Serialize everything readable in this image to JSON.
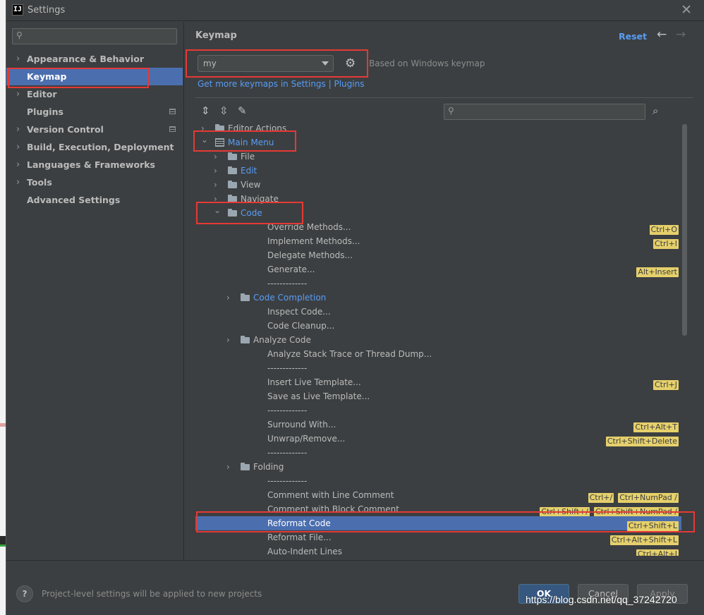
{
  "window": {
    "title": "Settings",
    "app_icon_text": "IJ"
  },
  "sidebar": {
    "search_placeholder": "",
    "items": [
      {
        "label": "Appearance & Behavior",
        "expandable": true
      },
      {
        "label": "Keymap",
        "expandable": false,
        "selected": true
      },
      {
        "label": "Editor",
        "expandable": true
      },
      {
        "label": "Plugins",
        "expandable": false,
        "side_icon": true
      },
      {
        "label": "Version Control",
        "expandable": true,
        "side_icon": true
      },
      {
        "label": "Build, Execution, Deployment",
        "expandable": true
      },
      {
        "label": "Languages & Frameworks",
        "expandable": true
      },
      {
        "label": "Tools",
        "expandable": true
      },
      {
        "label": "Advanced Settings",
        "expandable": false
      }
    ]
  },
  "header": {
    "title": "Keymap",
    "reset_label": "Reset"
  },
  "keymap": {
    "selected": "my",
    "based_on": "Based on Windows keymap",
    "link_settings": "Get more keymaps in Settings",
    "link_separator": " | ",
    "link_plugins": "Plugins"
  },
  "tree_search": {
    "placeholder": ""
  },
  "tree": [
    {
      "label": "Editor Actions",
      "indent": 0,
      "chevron": "right",
      "icon": "folder"
    },
    {
      "label": "Main Menu",
      "indent": 0,
      "chevron": "down",
      "icon": "menu",
      "blue": true
    },
    {
      "label": "File",
      "indent": 1,
      "chevron": "right",
      "icon": "folder"
    },
    {
      "label": "Edit",
      "indent": 1,
      "chevron": "right",
      "icon": "folder",
      "blue": true
    },
    {
      "label": "View",
      "indent": 1,
      "chevron": "right",
      "icon": "folder"
    },
    {
      "label": "Navigate",
      "indent": 1,
      "chevron": "right",
      "icon": "folder"
    },
    {
      "label": "Code",
      "indent": 1,
      "chevron": "down",
      "icon": "folder",
      "blue": true
    },
    {
      "label": "Override Methods...",
      "indent": 2,
      "shortcuts": [
        "Ctrl+O"
      ]
    },
    {
      "label": "Implement Methods...",
      "indent": 2,
      "shortcuts": [
        "Ctrl+I"
      ]
    },
    {
      "label": "Delegate Methods...",
      "indent": 2
    },
    {
      "label": "Generate...",
      "indent": 2,
      "shortcuts": [
        "Alt+Insert"
      ]
    },
    {
      "label": "-------------",
      "indent": 2
    },
    {
      "label": "Code Completion",
      "indent": 2,
      "chevron": "right",
      "icon": "folder",
      "blue": true
    },
    {
      "label": "Inspect Code...",
      "indent": 2
    },
    {
      "label": "Code Cleanup...",
      "indent": 2
    },
    {
      "label": "Analyze Code",
      "indent": 2,
      "chevron": "right",
      "icon": "folder"
    },
    {
      "label": "Analyze Stack Trace or Thread Dump...",
      "indent": 2
    },
    {
      "label": "-------------",
      "indent": 2
    },
    {
      "label": "Insert Live Template...",
      "indent": 2,
      "shortcuts": [
        "Ctrl+J"
      ]
    },
    {
      "label": "Save as Live Template...",
      "indent": 2
    },
    {
      "label": "-------------",
      "indent": 2
    },
    {
      "label": "Surround With...",
      "indent": 2,
      "shortcuts": [
        "Ctrl+Alt+T"
      ]
    },
    {
      "label": "Unwrap/Remove...",
      "indent": 2,
      "shortcuts": [
        "Ctrl+Shift+Delete"
      ]
    },
    {
      "label": "-------------",
      "indent": 2
    },
    {
      "label": "Folding",
      "indent": 2,
      "chevron": "right",
      "icon": "folder"
    },
    {
      "label": "-------------",
      "indent": 2
    },
    {
      "label": "Comment with Line Comment",
      "indent": 2,
      "shortcuts": [
        "Ctrl+/",
        "Ctrl+NumPad /"
      ]
    },
    {
      "label": "Comment with Block Comment",
      "indent": 2,
      "shortcuts": [
        "Ctrl+Shift+/",
        "Ctrl+Shift+NumPad /"
      ]
    },
    {
      "label": "Reformat Code",
      "indent": 2,
      "selected": true,
      "shortcuts": [
        "Ctrl+Shift+L"
      ]
    },
    {
      "label": "Reformat File...",
      "indent": 2,
      "shortcuts": [
        "Ctrl+Alt+Shift+L"
      ]
    },
    {
      "label": "Auto-Indent Lines",
      "indent": 2,
      "shortcuts": [
        "Ctrl+Alt+I"
      ]
    }
  ],
  "footer": {
    "help_label": "?",
    "note": "Project-level settings will be applied to new projects",
    "ok_label": "OK",
    "cancel_label": "Cancel",
    "apply_label": "Apply"
  },
  "watermark": "https://blog.csdn.net/qq_37242720",
  "colors": {
    "background": "#3c3f41",
    "selection": "#4b6eaf",
    "link": "#589df6",
    "shortcut_badge": "#e6d06b",
    "annotation_box": "#e53935",
    "ok_button": "#365880"
  },
  "icons": {
    "close": "close-icon",
    "search": "search-icon",
    "gear": "gear-icon",
    "back": "arrow-left-icon",
    "forward": "arrow-right-icon",
    "expand_all": "expand-all-icon",
    "collapse_all": "collapse-all-icon",
    "edit": "pencil-icon",
    "find_by_shortcut": "find-shortcut-icon"
  }
}
